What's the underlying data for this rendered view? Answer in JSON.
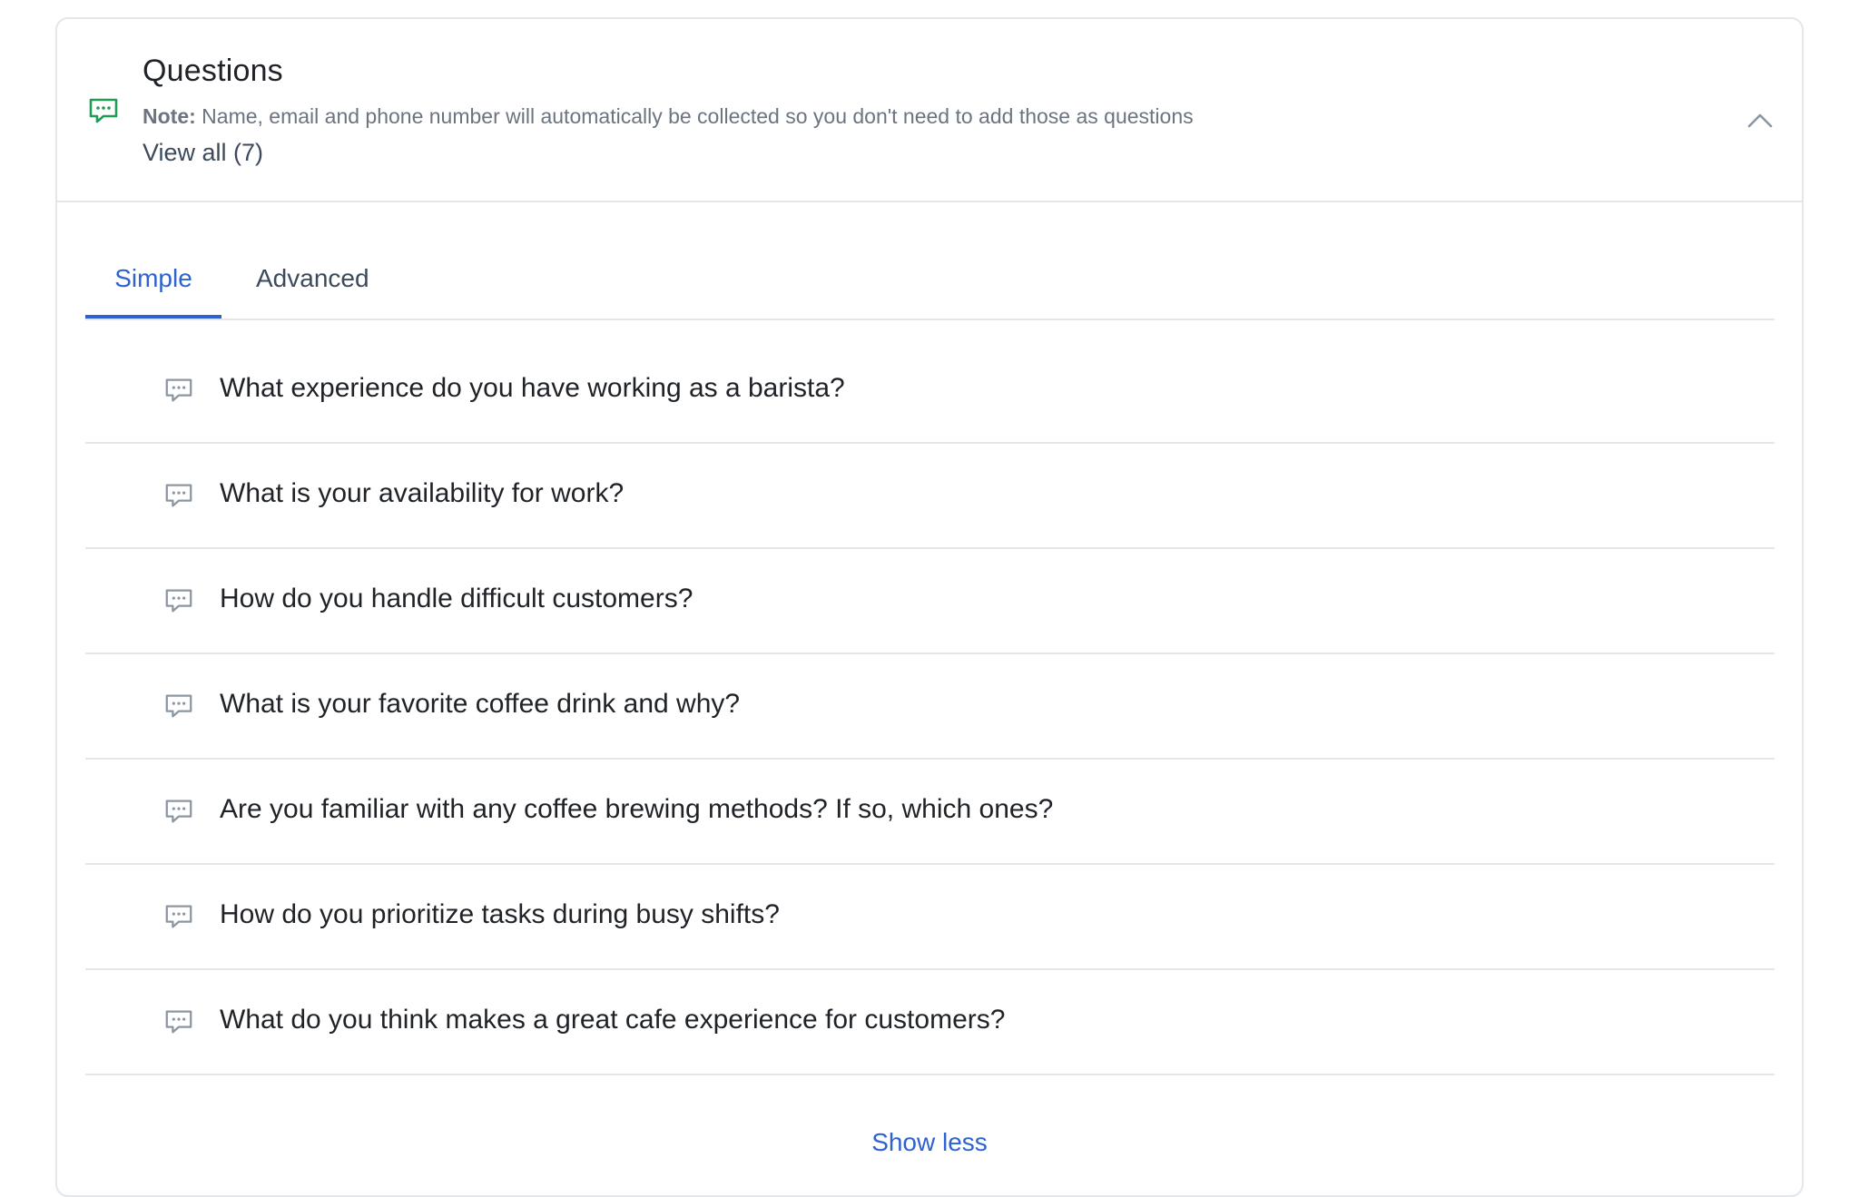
{
  "header": {
    "title": "Questions",
    "note_label": "Note:",
    "note_text": " Name, email and phone number will automatically be collected so you don't need to add those as questions",
    "view_all": "View all (7)",
    "icon": "chat-bubble-icon",
    "icon_color": "#1f9d55"
  },
  "tabs": [
    {
      "label": "Simple",
      "active": true
    },
    {
      "label": "Advanced",
      "active": false
    }
  ],
  "questions": [
    "What experience do you have working as a barista?",
    "What is your availability for work?",
    "How do you handle difficult customers?",
    "What is your favorite coffee drink and why?",
    "Are you familiar with any coffee brewing methods? If so, which ones?",
    "How do you prioritize tasks during busy shifts?",
    "What do you think makes a great cafe experience for customers?"
  ],
  "footer": {
    "show_less": "Show less"
  },
  "colors": {
    "accent": "#2d62cf",
    "border": "#e3e6ea",
    "icon_gray": "#8c96a3"
  }
}
